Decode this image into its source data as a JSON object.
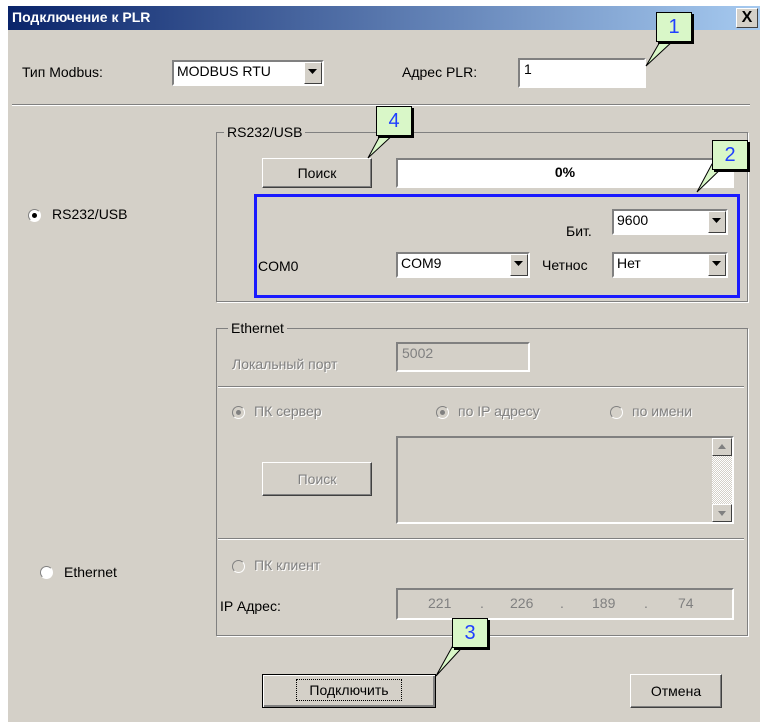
{
  "window": {
    "title": "Подключение к PLR",
    "close_glyph": "X"
  },
  "modbus": {
    "type_label": "Тип Modbus:",
    "type_value": "MODBUS RTU",
    "address_label": "Адрес PLR:",
    "address_value": "1"
  },
  "rs232": {
    "radio_label": "RS232/USB",
    "group_title": "RS232/USB",
    "search_button": "Поиск",
    "progress_text": "0%",
    "port_label": "COM0",
    "port_value": "COM9",
    "baud_label": "Бит.",
    "baud_value": "9600",
    "parity_label": "Четнос",
    "parity_value": "Нет"
  },
  "ethernet": {
    "radio_label": "Ethernet",
    "group_title": "Ethernet",
    "local_port_label": "Локальный порт",
    "local_port_value": "5002",
    "pc_server_label": "ПК сервер",
    "by_ip_label": "по IP адресу",
    "by_name_label": "по имени",
    "search_button": "Поиск",
    "pc_client_label": "ПК клиент",
    "ip_label": "IP Адрес:",
    "ip_octets": [
      "221",
      "226",
      "189",
      "74"
    ]
  },
  "footer": {
    "connect_button": "Подключить",
    "cancel_button": "Отмена"
  },
  "callouts": [
    "1",
    "2",
    "3",
    "4"
  ],
  "colors": {
    "title_gradient_start": "#0a246a",
    "highlight_rect": "#1a1aff",
    "callout_fill": "#d9f7c8",
    "callout_text": "#1f3fff"
  }
}
